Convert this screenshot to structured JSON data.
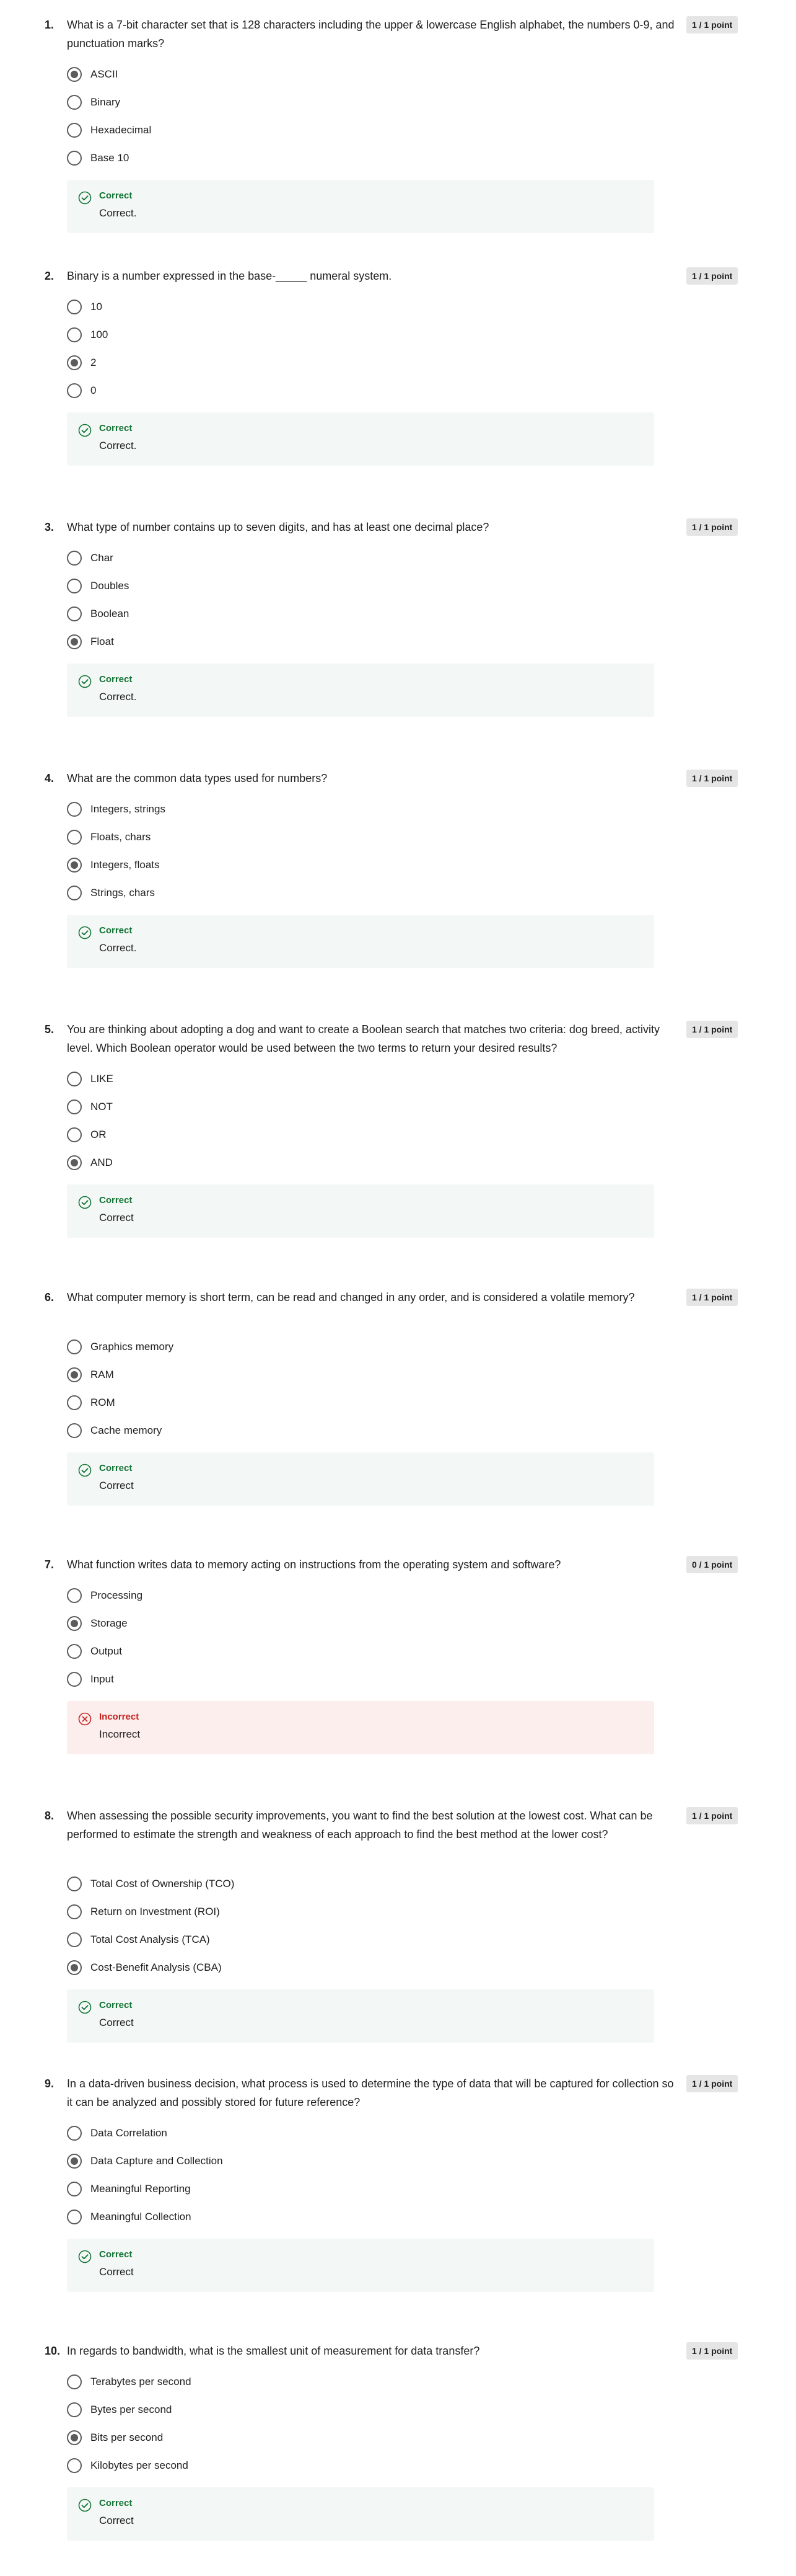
{
  "questions": [
    {
      "number": "1.",
      "text": "What is a 7-bit character set that is 128 characters including the upper & lowercase English alphabet, the numbers 0-9, and punctuation marks?",
      "points": "1 / 1 point",
      "options": [
        "ASCII",
        "Binary",
        "Hexadecimal",
        "Base 10"
      ],
      "selected": 0,
      "result": "correct",
      "status": "Correct",
      "feedback": "Correct."
    },
    {
      "number": "2.",
      "text": "Binary is a number expressed in the base-_____ numeral system.",
      "points": "1 / 1 point",
      "options": [
        "10",
        "100",
        "2",
        "0"
      ],
      "selected": 2,
      "result": "correct",
      "status": "Correct",
      "feedback": "Correct."
    },
    {
      "number": "3.",
      "text": "What type of number contains up to seven digits, and has at least one decimal place?",
      "points": "1 / 1 point",
      "options": [
        "Char",
        "Doubles",
        "Boolean",
        "Float"
      ],
      "selected": 3,
      "result": "correct",
      "status": "Correct",
      "feedback": "Correct."
    },
    {
      "number": "4.",
      "text": "What are the common data types used for numbers?",
      "points": "1 / 1 point",
      "options": [
        "Integers, strings",
        "Floats, chars",
        "Integers, floats",
        "Strings, chars"
      ],
      "selected": 2,
      "result": "correct",
      "status": "Correct",
      "feedback": "Correct."
    },
    {
      "number": "5.",
      "text": "You are thinking about adopting a dog and want to create a Boolean search that matches two criteria: dog breed, activity level. Which Boolean operator would be used between the two terms to return your desired results?",
      "points": "1 / 1 point",
      "options": [
        "LIKE",
        "NOT",
        "OR",
        "AND"
      ],
      "selected": 3,
      "result": "correct",
      "status": "Correct",
      "feedback": "Correct"
    },
    {
      "number": "6.",
      "text": "What computer memory is short term, can be read and changed in any order, and is considered a volatile memory?",
      "points": "1 / 1 point",
      "options": [
        "Graphics memory",
        "RAM",
        "ROM",
        "Cache memory"
      ],
      "selected": 1,
      "result": "correct",
      "status": "Correct",
      "feedback": "Correct"
    },
    {
      "number": "7.",
      "text": "What function writes data to memory acting on instructions from the operating system and software?",
      "points": "0 / 1 point",
      "options": [
        "Processing",
        "Storage",
        "Output",
        "Input"
      ],
      "selected": 1,
      "result": "incorrect",
      "status": "Incorrect",
      "feedback": "Incorrect"
    },
    {
      "number": "8.",
      "text": "When assessing the possible security improvements, you want to find the best solution at the lowest cost. What can be performed to estimate the strength and weakness of each approach to find the best method at the lower cost?",
      "points": "1 / 1 point",
      "options": [
        "Total Cost of Ownership (TCO)",
        "Return on Investment (ROI)",
        "Total Cost Analysis (TCA)",
        "Cost-Benefit Analysis (CBA)"
      ],
      "selected": 3,
      "result": "correct",
      "status": "Correct",
      "feedback": "Correct"
    },
    {
      "number": "9.",
      "text": "In a data-driven business decision, what process is used to determine the type of data that will be captured for collection so it can be analyzed and possibly stored for future reference?",
      "points": "1 / 1 point",
      "options": [
        "Data Correlation",
        "Data Capture and Collection",
        "Meaningful Reporting",
        "Meaningful Collection"
      ],
      "selected": 1,
      "result": "correct",
      "status": "Correct",
      "feedback": "Correct"
    },
    {
      "number": "10.",
      "text": "In regards to bandwidth, what is the smallest unit of measurement for data transfer?",
      "points": "1 / 1 point",
      "options": [
        "Terabytes per second",
        "Bytes per second",
        "Bits per second",
        "Kilobytes per second"
      ],
      "selected": 2,
      "result": "correct",
      "status": "Correct",
      "feedback": "Correct"
    }
  ]
}
